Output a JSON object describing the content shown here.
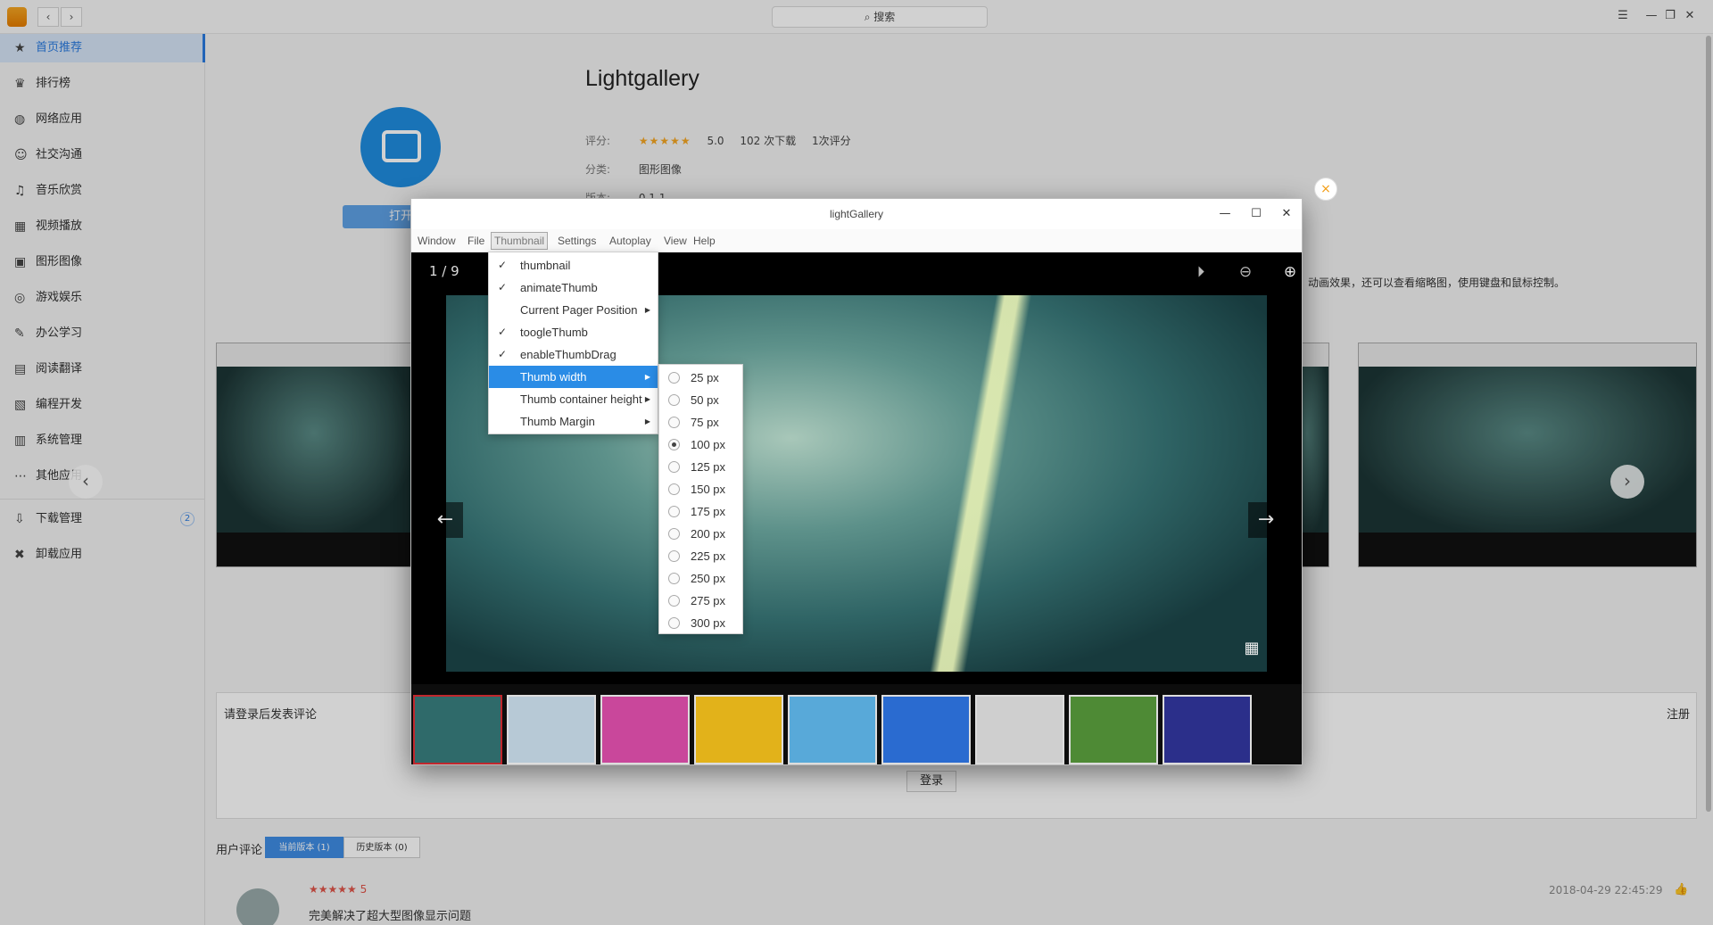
{
  "store": {
    "search_placeholder": "搜索",
    "nav_back": "‹",
    "nav_forward": "›",
    "sidebar": [
      {
        "label": "首页推荐",
        "icon": "star-icon",
        "glyph": "★",
        "active": true
      },
      {
        "label": "排行榜",
        "icon": "ranking-icon",
        "glyph": "♛"
      },
      {
        "label": "网络应用",
        "icon": "globe-icon",
        "glyph": "◍"
      },
      {
        "label": "社交沟通",
        "icon": "chat-icon",
        "glyph": "☺"
      },
      {
        "label": "音乐欣赏",
        "icon": "music-icon",
        "glyph": "♫"
      },
      {
        "label": "视频播放",
        "icon": "film-icon",
        "glyph": "▦"
      },
      {
        "label": "图形图像",
        "icon": "image-icon",
        "glyph": "▣"
      },
      {
        "label": "游戏娱乐",
        "icon": "gamepad-icon",
        "glyph": "◎"
      },
      {
        "label": "办公学习",
        "icon": "office-icon",
        "glyph": "✎"
      },
      {
        "label": "阅读翻译",
        "icon": "book-icon",
        "glyph": "▤"
      },
      {
        "label": "编程开发",
        "icon": "code-icon",
        "glyph": "▧"
      },
      {
        "label": "系统管理",
        "icon": "system-icon",
        "glyph": "▥"
      },
      {
        "label": "其他应用",
        "icon": "more-icon",
        "glyph": "⋯"
      }
    ],
    "sidebar_bottom": [
      {
        "label": "下载管理",
        "icon": "download-icon",
        "glyph": "⇩",
        "badge": "2"
      },
      {
        "label": "卸载应用",
        "icon": "trash-icon",
        "glyph": "✖"
      }
    ],
    "app": {
      "name": "Lightgallery",
      "open_button": "打开",
      "rating_label": "评分:",
      "stars": "★★★★★",
      "score": "5.0",
      "downloads": "102 次下载",
      "rating_count": "1次评分",
      "category_label": "分类:",
      "category": "图形图像",
      "version_label": "版本:",
      "version": "0.1.1",
      "description_visible": "动画效果，还可以查看缩略图，使用键盘和鼠标控制。"
    },
    "comments": {
      "hint": "请登录后发表评论",
      "register": "注册",
      "login": "登录",
      "reviews_label": "用户评论",
      "tab_current": "当前版本 (1)",
      "tab_history": "历史版本 (0)",
      "review_stars": "★★★★★ 5",
      "review_text": "完美解决了超大型图像显示问题",
      "review_date": "2018-04-29 22:45:29"
    },
    "preview_close": "×"
  },
  "lg": {
    "title": "lightGallery",
    "menus": [
      "Window",
      "File",
      "Thumbnail",
      "Settings",
      "Autoplay",
      "View",
      "Help"
    ],
    "open_menu": "Thumbnail",
    "counter": "1 / 9",
    "thumbnail_menu": [
      {
        "label": "thumbnail",
        "checked": true
      },
      {
        "label": "animateThumb",
        "checked": true
      },
      {
        "label": "Current Pager Position",
        "submenu": true
      },
      {
        "label": "toogleThumb",
        "checked": true
      },
      {
        "label": "enableThumbDrag",
        "checked": true
      },
      {
        "label": "Thumb width",
        "submenu": true,
        "highlighted": true
      },
      {
        "label": "Thumb container height",
        "submenu": true
      },
      {
        "label": "Thumb Margin",
        "submenu": true
      }
    ],
    "thumb_width_options": [
      "25 px",
      "50 px",
      "75 px",
      "100 px",
      "125 px",
      "150 px",
      "175 px",
      "200 px",
      "225 px",
      "250 px",
      "275 px",
      "300 px"
    ],
    "thumb_width_selected": "100 px",
    "thumbnails": [
      {
        "name": "thumb-teal-architecture",
        "bg": "#2f6a6a"
      },
      {
        "name": "thumb-bridge-sea",
        "bg": "#b7c9d6"
      },
      {
        "name": "thumb-pink-stripes",
        "bg": "#c9479b"
      },
      {
        "name": "thumb-sunflower",
        "bg": "#e2b21a"
      },
      {
        "name": "thumb-building-sky",
        "bg": "#58a9d9"
      },
      {
        "name": "thumb-blue-sky-crowd",
        "bg": "#2a6bd0"
      },
      {
        "name": "thumb-misty-cliff",
        "bg": "#cfcfcf"
      },
      {
        "name": "thumb-green-forest",
        "bg": "#4e8a35"
      },
      {
        "name": "thumb-purple-trees",
        "bg": "#2b2f8a"
      }
    ],
    "colors": {
      "highlight": "#2a8ce6",
      "active_thumb_border": "#c0272d"
    }
  }
}
